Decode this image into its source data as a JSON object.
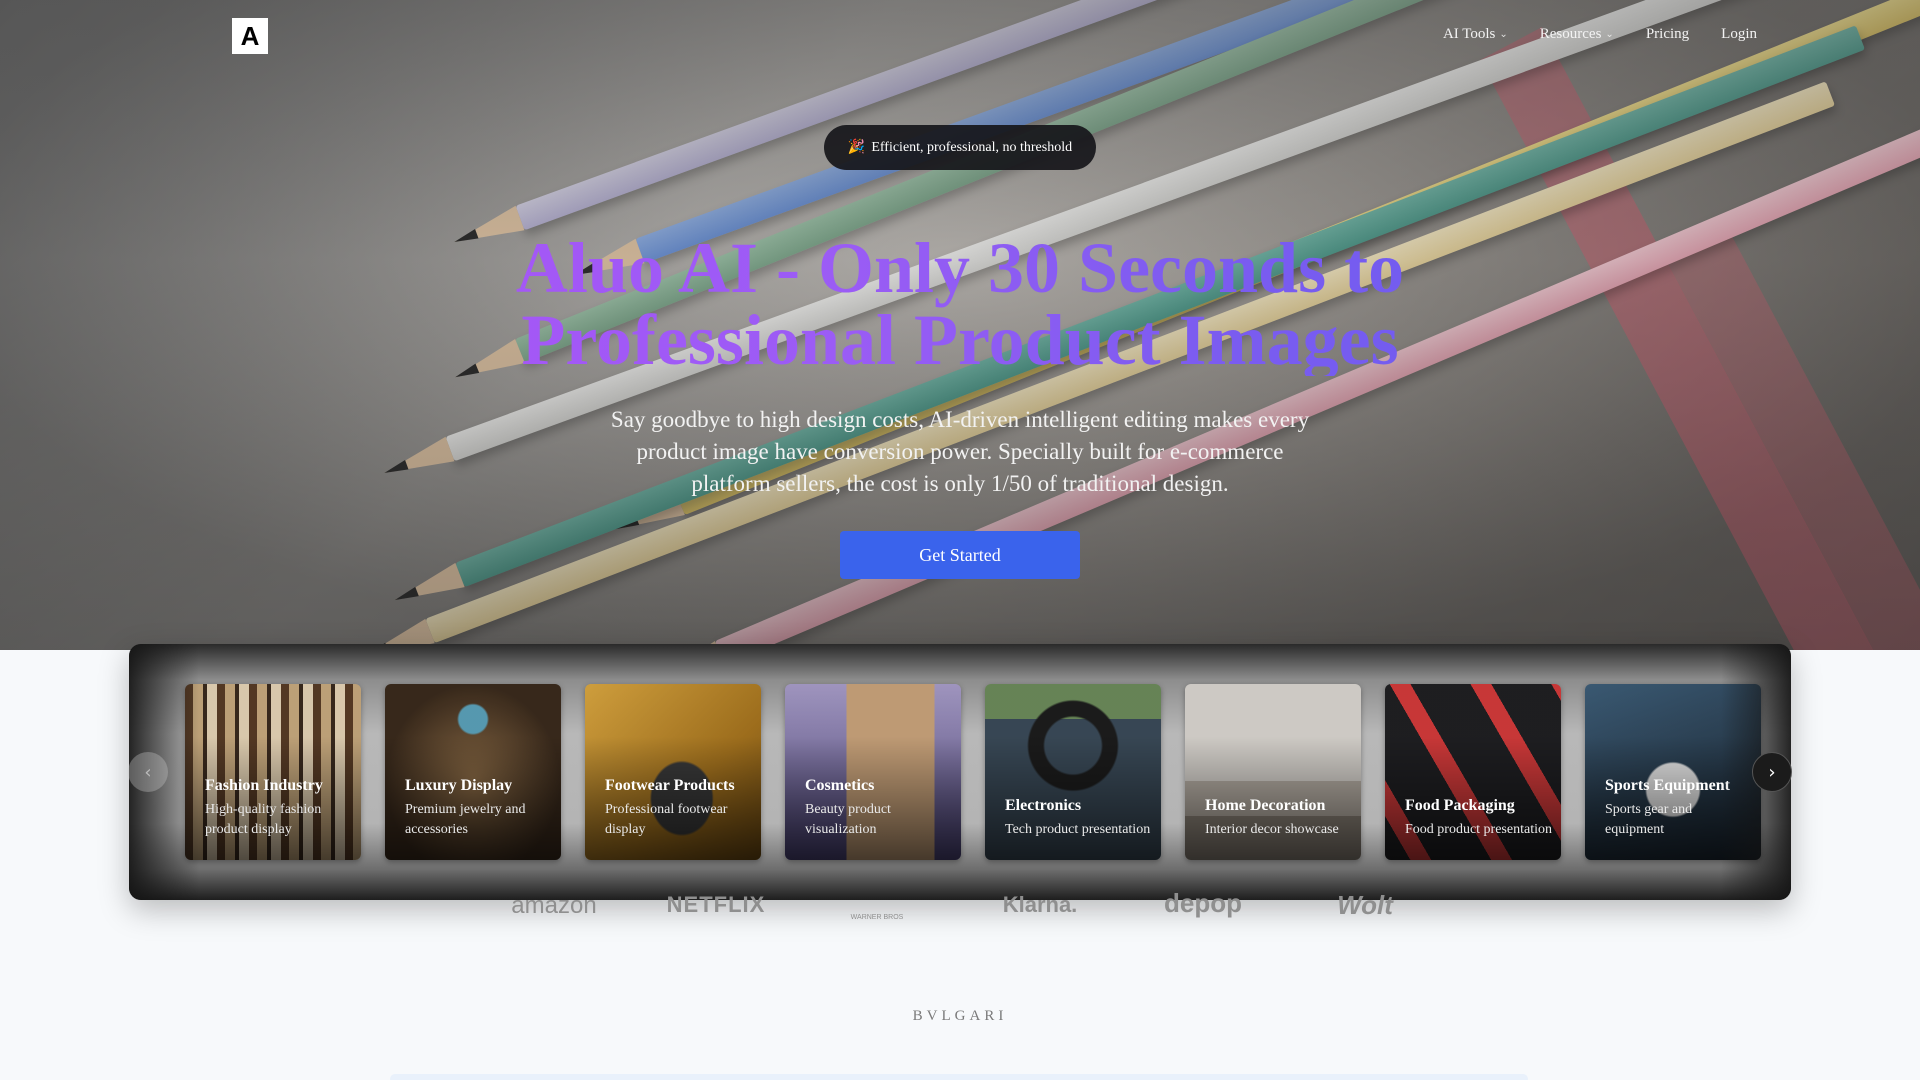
{
  "nav": {
    "logo_letter": "A",
    "items": [
      {
        "label": "AI Tools",
        "dropdown": true
      },
      {
        "label": "Resources",
        "dropdown": true
      },
      {
        "label": "Pricing",
        "dropdown": false
      },
      {
        "label": "Login",
        "dropdown": false
      }
    ]
  },
  "hero": {
    "badge_icon": "🎉",
    "badge_text": "Efficient, professional, no threshold",
    "headline_line1": "Aluo AI - Only 30 Seconds to",
    "headline_line2": "Professional Product Images",
    "subtitle": "Say goodbye to high design costs, AI-driven intelligent editing makes every product image have conversion power. Specially built for e-commerce platform sellers, the cost is only 1/50 of traditional design.",
    "cta_label": "Get Started"
  },
  "carousel": {
    "prev_icon": "chevron-left-icon",
    "next_icon": "chevron-right-icon",
    "cards": [
      {
        "title": "Fashion Industry",
        "desc": "High-quality fashion product display"
      },
      {
        "title": "Luxury Display",
        "desc": "Premium jewelry and accessories"
      },
      {
        "title": "Footwear Products",
        "desc": "Professional footwear display"
      },
      {
        "title": "Cosmetics",
        "desc": "Beauty product visualization"
      },
      {
        "title": "Electronics",
        "desc": "Tech product presentation"
      },
      {
        "title": "Home Decoration",
        "desc": "Interior decor showcase"
      },
      {
        "title": "Food Packaging",
        "desc": "Food product presentation"
      },
      {
        "title": "Sports Equipment",
        "desc": "Sports gear and equipment"
      }
    ]
  },
  "brands": [
    "amazon",
    "NETFLIX",
    "WARNER BROS",
    "Klarna.",
    "depop",
    "Wolt"
  ],
  "brand_bottom": "BVLGARI",
  "colors": {
    "accent_button": "#3a63ec",
    "headline_gradient_start": "#a855f7",
    "headline_gradient_end": "#6d5df0"
  }
}
